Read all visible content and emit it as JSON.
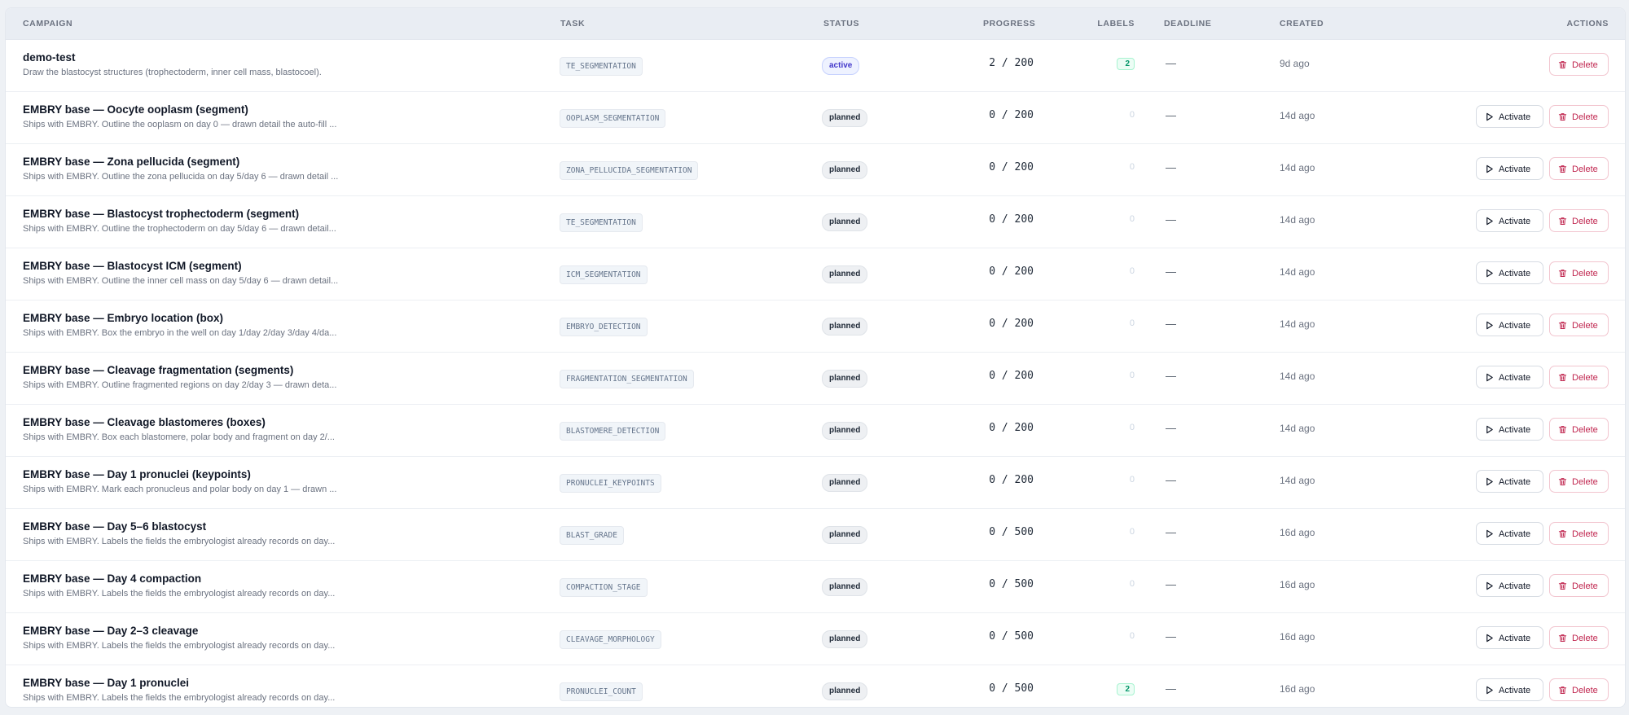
{
  "table": {
    "columns": {
      "campaign": "CAMPAIGN",
      "task": "TASK",
      "status": "STATUS",
      "progress": "PROGRESS",
      "labels": "LABELS",
      "deadline": "DEADLINE",
      "created": "CREATED",
      "actions": "ACTIONS"
    },
    "action_labels": {
      "activate": "Activate",
      "delete": "Delete"
    },
    "rows": [
      {
        "title": "demo-test",
        "desc": "Draw the blastocyst structures (trophectoderm, inner cell mass, blastocoel).",
        "task": "TE_SEGMENTATION",
        "status": "active",
        "progress": "2 / 200",
        "labels": "2",
        "deadline": "—",
        "created": "9d ago",
        "can_activate": false
      },
      {
        "title": "EMBRY base — Oocyte ooplasm (segment)",
        "desc": "Ships with EMBRY. Outline the ooplasm on day 0 — drawn detail the auto-fill ...",
        "task": "OOPLASM_SEGMENTATION",
        "status": "planned",
        "progress": "0 / 200",
        "labels": "0",
        "deadline": "—",
        "created": "14d ago",
        "can_activate": true
      },
      {
        "title": "EMBRY base — Zona pellucida (segment)",
        "desc": "Ships with EMBRY. Outline the zona pellucida on day 5/day 6 — drawn detail ...",
        "task": "ZONA_PELLUCIDA_SEGMENTATION",
        "status": "planned",
        "progress": "0 / 200",
        "labels": "0",
        "deadline": "—",
        "created": "14d ago",
        "can_activate": true
      },
      {
        "title": "EMBRY base — Blastocyst trophectoderm (segment)",
        "desc": "Ships with EMBRY. Outline the trophectoderm on day 5/day 6 — drawn detail...",
        "task": "TE_SEGMENTATION",
        "status": "planned",
        "progress": "0 / 200",
        "labels": "0",
        "deadline": "—",
        "created": "14d ago",
        "can_activate": true
      },
      {
        "title": "EMBRY base — Blastocyst ICM (segment)",
        "desc": "Ships with EMBRY. Outline the inner cell mass on day 5/day 6 — drawn detail...",
        "task": "ICM_SEGMENTATION",
        "status": "planned",
        "progress": "0 / 200",
        "labels": "0",
        "deadline": "—",
        "created": "14d ago",
        "can_activate": true
      },
      {
        "title": "EMBRY base — Embryo location (box)",
        "desc": "Ships with EMBRY. Box the embryo in the well on day 1/day 2/day 3/day 4/da...",
        "task": "EMBRYO_DETECTION",
        "status": "planned",
        "progress": "0 / 200",
        "labels": "0",
        "deadline": "—",
        "created": "14d ago",
        "can_activate": true
      },
      {
        "title": "EMBRY base — Cleavage fragmentation (segments)",
        "desc": "Ships with EMBRY. Outline fragmented regions on day 2/day 3 — drawn deta...",
        "task": "FRAGMENTATION_SEGMENTATION",
        "status": "planned",
        "progress": "0 / 200",
        "labels": "0",
        "deadline": "—",
        "created": "14d ago",
        "can_activate": true
      },
      {
        "title": "EMBRY base — Cleavage blastomeres (boxes)",
        "desc": "Ships with EMBRY. Box each blastomere, polar body and fragment on day 2/...",
        "task": "BLASTOMERE_DETECTION",
        "status": "planned",
        "progress": "0 / 200",
        "labels": "0",
        "deadline": "—",
        "created": "14d ago",
        "can_activate": true
      },
      {
        "title": "EMBRY base — Day 1 pronuclei (keypoints)",
        "desc": "Ships with EMBRY. Mark each pronucleus and polar body on day 1 — drawn ...",
        "task": "PRONUCLEI_KEYPOINTS",
        "status": "planned",
        "progress": "0 / 200",
        "labels": "0",
        "deadline": "—",
        "created": "14d ago",
        "can_activate": true
      },
      {
        "title": "EMBRY base — Day 5–6 blastocyst",
        "desc": "Ships with EMBRY. Labels the fields the embryologist already records on day...",
        "task": "BLAST_GRADE",
        "status": "planned",
        "progress": "0 / 500",
        "labels": "0",
        "deadline": "—",
        "created": "16d ago",
        "can_activate": true
      },
      {
        "title": "EMBRY base — Day 4 compaction",
        "desc": "Ships with EMBRY. Labels the fields the embryologist already records on day...",
        "task": "COMPACTION_STAGE",
        "status": "planned",
        "progress": "0 / 500",
        "labels": "0",
        "deadline": "—",
        "created": "16d ago",
        "can_activate": true
      },
      {
        "title": "EMBRY base — Day 2–3 cleavage",
        "desc": "Ships with EMBRY. Labels the fields the embryologist already records on day...",
        "task": "CLEAVAGE_MORPHOLOGY",
        "status": "planned",
        "progress": "0 / 500",
        "labels": "0",
        "deadline": "—",
        "created": "16d ago",
        "can_activate": true
      },
      {
        "title": "EMBRY base — Day 1 pronuclei",
        "desc": "Ships with EMBRY. Labels the fields the embryologist already records on day...",
        "task": "PRONUCLEI_COUNT",
        "status": "planned",
        "progress": "0 / 500",
        "labels": "2",
        "deadline": "—",
        "created": "16d ago",
        "can_activate": true
      }
    ]
  },
  "icons": {
    "activate": "play-icon",
    "delete": "trash-icon"
  },
  "colors": {
    "active_badge": "#4338ca",
    "delete": "#c0264f",
    "labels_badge": "#059669"
  }
}
